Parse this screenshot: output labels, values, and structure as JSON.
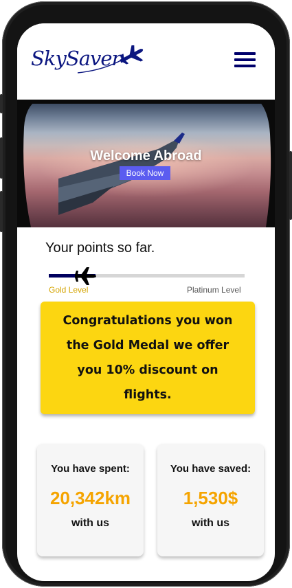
{
  "app": {
    "logo_text": "SkySaver",
    "logo_icon": "airplane-icon",
    "menu_icon": "hamburger-menu-icon"
  },
  "hero": {
    "title": "Welcome Abroad",
    "book_button": "Book Now"
  },
  "points": {
    "title": "Your points so far.",
    "progress": 0.24,
    "marker_icon": "airplane-icon",
    "level_current": "Gold Level",
    "level_next": "Platinum Level"
  },
  "congrats": {
    "message": "Congratulations you won the Gold Medal we offer you 10% discount on flights."
  },
  "stats": {
    "spent": {
      "label": "You have spent:",
      "value": "20,342km",
      "suffix": "with us"
    },
    "saved": {
      "label": "You have saved:",
      "value": "1,530$",
      "suffix": "with us"
    }
  },
  "colors": {
    "brand_navy": "#0b1680",
    "accent_yellow": "#fcd611",
    "value_orange": "#f5a400",
    "button_blue": "#5b5cf0"
  }
}
